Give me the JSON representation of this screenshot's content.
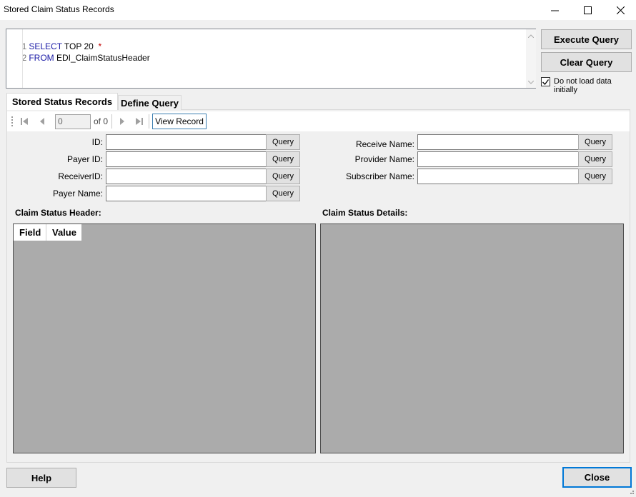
{
  "window": {
    "title": "Stored Claim Status Records"
  },
  "editor": {
    "lines": [
      {
        "num": "1",
        "keyword": "SELECT",
        "rest": " TOP 20  ",
        "star": "*"
      },
      {
        "num": "2",
        "keyword": "FROM",
        "rest": " EDI_ClaimStatusHeader",
        "star": ""
      }
    ]
  },
  "actions": {
    "execute_label": "Execute Query",
    "clear_label": "Clear Query",
    "no_load_label": "Do not load data initially",
    "no_load_checked": true
  },
  "tabs": [
    {
      "label": "Stored Status Records",
      "active": true
    },
    {
      "label": "Define Query",
      "active": false
    }
  ],
  "navigator": {
    "position": "0",
    "of_label": "of 0",
    "view_label": "View Record"
  },
  "fields_left": [
    {
      "label": "ID:",
      "value": "",
      "button": "Query"
    },
    {
      "label": "Payer ID:",
      "value": "",
      "button": "Query"
    },
    {
      "label": "ReceiverID:",
      "value": "",
      "button": "Query"
    },
    {
      "label": "Payer Name:",
      "value": "",
      "button": "Query"
    }
  ],
  "fields_right": [
    {
      "label": "Receive Name:",
      "value": "",
      "button": "Query"
    },
    {
      "label": "Provider Name:",
      "value": "",
      "button": "Query"
    },
    {
      "label": "Subscriber Name:",
      "value": "",
      "button": "Query"
    }
  ],
  "sections": {
    "header_title": "Claim Status Header:",
    "details_title": "Claim Status Details:",
    "header_columns": [
      "Field",
      "Value"
    ]
  },
  "footer": {
    "help_label": "Help",
    "close_label": "Close"
  },
  "colors": {
    "keyword": "#1a1aa6",
    "accent": "#0078d7",
    "panel": "#ababab"
  }
}
